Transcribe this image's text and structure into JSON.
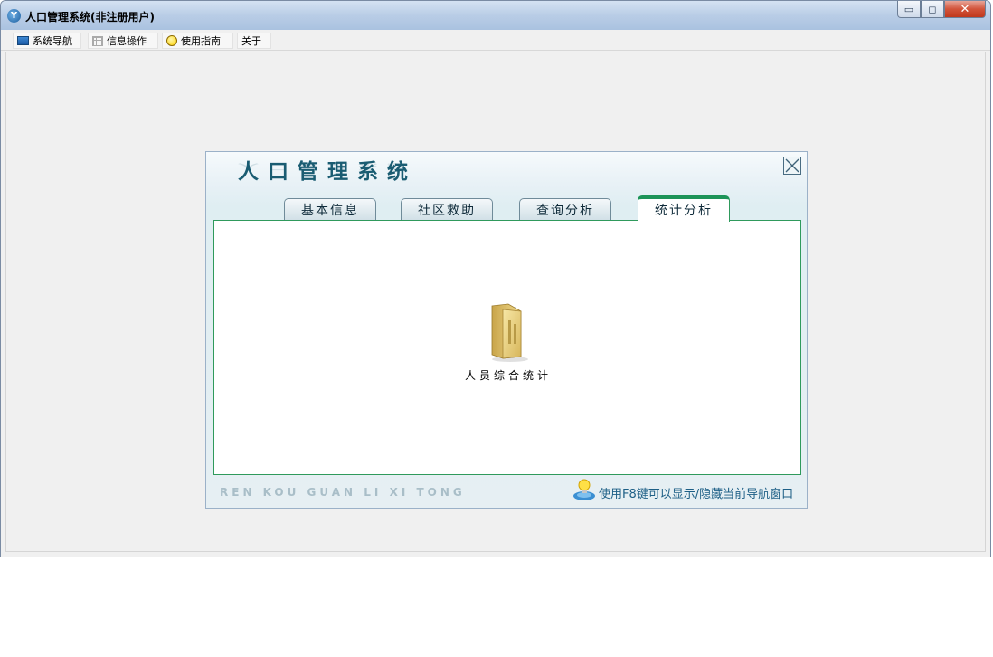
{
  "window": {
    "title": "人口管理系统(非注册用户)",
    "app_icon": "Y",
    "controls": {
      "minimize": "▭",
      "maximize": "◻",
      "close": "✕"
    }
  },
  "menu": {
    "items": [
      {
        "label": "系统导航",
        "icon": "screen-icon"
      },
      {
        "label": "信息操作",
        "icon": "grid-icon"
      },
      {
        "label": "使用指南",
        "icon": "help-icon"
      },
      {
        "label": "关于",
        "icon": ""
      }
    ]
  },
  "panel": {
    "title": "人口管理系统",
    "tabs": [
      {
        "label": "基本信息",
        "active": false
      },
      {
        "label": "社区救助",
        "active": false
      },
      {
        "label": "查询分析",
        "active": false
      },
      {
        "label": "统计分析",
        "active": true
      }
    ],
    "features": [
      {
        "label": "人员综合统计",
        "icon": "folder-documents-icon"
      }
    ],
    "footer_brand": "REN KOU GUAN LI XI TONG",
    "footer_tip": "使用F8键可以显示/隐藏当前导航窗口"
  },
  "colors": {
    "accent_green": "#1c9458",
    "title_teal": "#1a5c72",
    "tip_blue": "#1d5f86"
  }
}
